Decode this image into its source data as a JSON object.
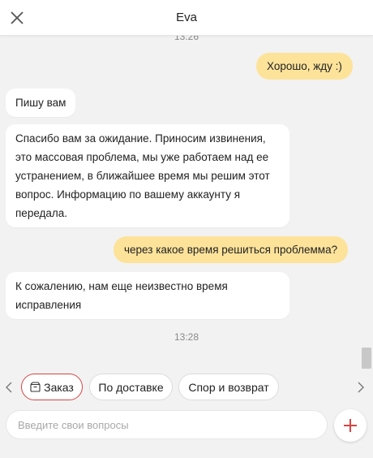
{
  "header": {
    "title": "Eva",
    "close_icon": "close-icon"
  },
  "chat": {
    "timestamp_top": "13:26",
    "messages": [
      {
        "side": "out",
        "text": "Хорошо, жду :)"
      },
      {
        "side": "in",
        "text": "Пишу вам"
      },
      {
        "side": "in",
        "text": "Спасибо вам за ожидание. Приносим извинения, это массовая проблема, мы уже работаем над ее устранением, в ближайшее время мы решим этот вопрос. Информацию по вашему аккаунту я передала."
      },
      {
        "side": "out",
        "text": "через какое время решиться проблемма?"
      },
      {
        "side": "in",
        "text": "К сожалению, нам еще неизвестно время исправления"
      }
    ],
    "timestamp_mid": "13:28"
  },
  "quick_replies": {
    "items": [
      {
        "label": "Заказ",
        "icon": "box-icon",
        "active": true
      },
      {
        "label": "По доставке"
      },
      {
        "label": "Спор и возврат"
      }
    ]
  },
  "composer": {
    "placeholder": "Введите свои вопросы",
    "value": ""
  },
  "colors": {
    "outgoing_bubble": "#fde39a",
    "accent_red": "#d64545",
    "background": "#f2f2f2"
  }
}
